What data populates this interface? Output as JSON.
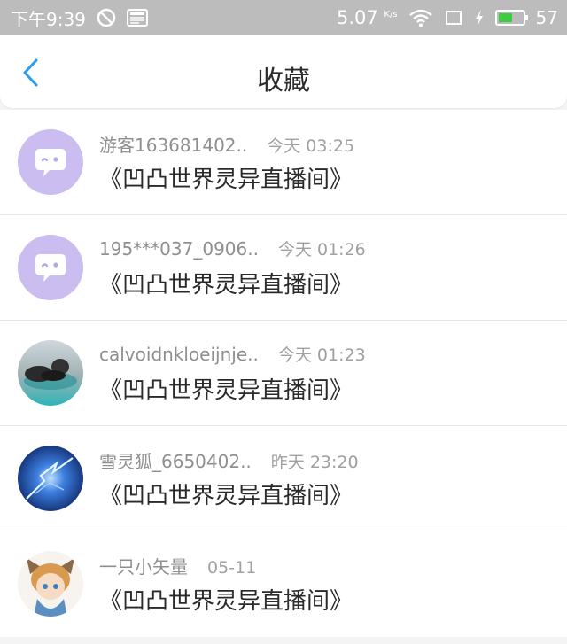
{
  "status_bar": {
    "time": "下午9:39",
    "speed": "5.07",
    "speed_unit": "K/s",
    "battery": "57",
    "battery_level": 0.57
  },
  "header": {
    "title": "收藏"
  },
  "favorites": [
    {
      "user": "游客163681402..",
      "time": "今天 03:25",
      "room": "《凹凸世界灵异直播间》"
    },
    {
      "user": "195***037_0906..",
      "time": "今天 01:26",
      "room": "《凹凸世界灵异直播间》"
    },
    {
      "user": "calvoidnkloeijnje..",
      "time": "今天 01:23",
      "room": "《凹凸世界灵异直播间》"
    },
    {
      "user": "雪灵狐_6650402..",
      "time": "昨天 23:20",
      "room": "《凹凸世界灵异直播间》"
    },
    {
      "user": "一只小矢量",
      "time": "05-11",
      "room": "《凹凸世界灵异直播间》"
    }
  ],
  "colors": {
    "accent": "#2c9cf0",
    "default_avatar": "#cbbdf0"
  }
}
